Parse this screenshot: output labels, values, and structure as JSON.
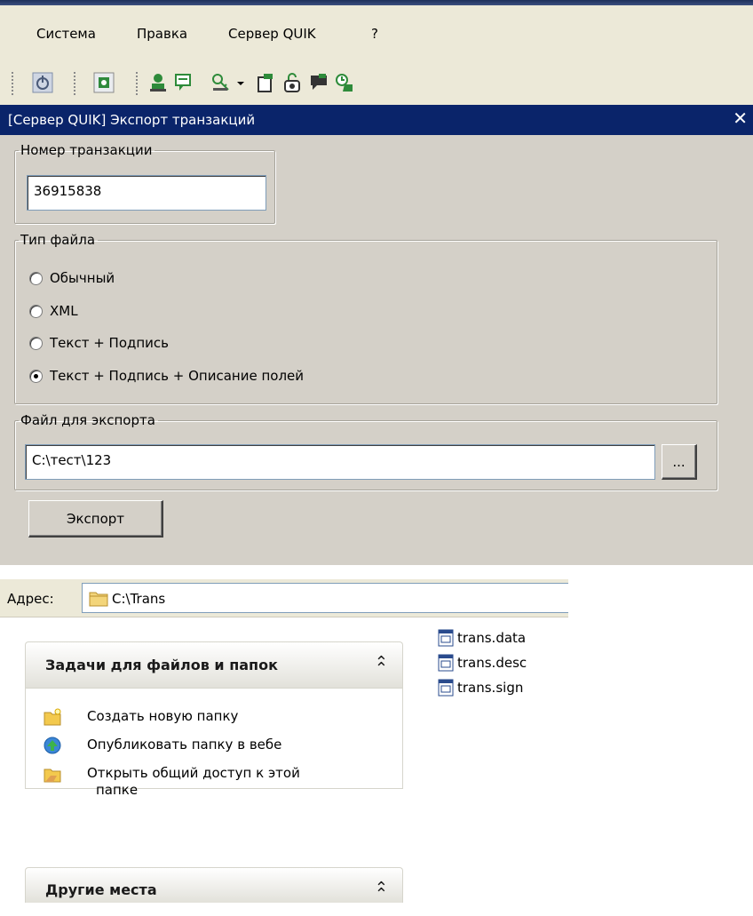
{
  "menu": {
    "items": [
      {
        "label": "Система"
      },
      {
        "label": "Правка"
      },
      {
        "label": "Сервер QUIK"
      },
      {
        "label": "?"
      }
    ]
  },
  "toolbar": {
    "icons": [
      "power-icon",
      "settings-icon",
      "user-connect-icon",
      "messages-icon",
      "key-icon",
      "dropdown-arrow-icon",
      "document-flag-icon",
      "lock-icon",
      "chat-icon",
      "user-clock-icon"
    ]
  },
  "dialog": {
    "title": "[Сервер QUIK] Экспорт транзакций",
    "close": "✕",
    "transaction_group": {
      "legend": "Номер транзакции",
      "value": "36915838"
    },
    "file_type_group": {
      "legend": "Тип файла",
      "options": [
        {
          "label": "Обычный",
          "selected": false
        },
        {
          "label": "XML",
          "selected": false
        },
        {
          "label": "Текст + Подпись",
          "selected": false
        },
        {
          "label": "Текст + Подпись + Описание полей",
          "selected": true
        }
      ]
    },
    "export_file_group": {
      "legend": "Файл для экспорта",
      "value": "C:\\тест\\123",
      "browse_label": "..."
    },
    "export_button": "Экспорт"
  },
  "explorer": {
    "address_label": "Адрес:",
    "address_value": "C:\\Trans",
    "tasks_panel": {
      "title": "Задачи для файлов и папок",
      "chevron": "⌃",
      "links": [
        {
          "label": "Создать новую папку",
          "icon": "new-folder-icon"
        },
        {
          "label": "Опубликовать папку в вебе",
          "icon": "globe-icon"
        },
        {
          "label": "Открыть общий доступ к этой",
          "label2": "папке",
          "icon": "share-folder-icon"
        }
      ]
    },
    "other_places_panel": {
      "title": "Другие места",
      "chevron": "⌃"
    },
    "files": [
      {
        "name": "trans.data"
      },
      {
        "name": "trans.desc"
      },
      {
        "name": "trans.sign"
      }
    ],
    "colors": {
      "title_bar": "#0a246a",
      "window_bg": "#d4d0c8"
    }
  }
}
